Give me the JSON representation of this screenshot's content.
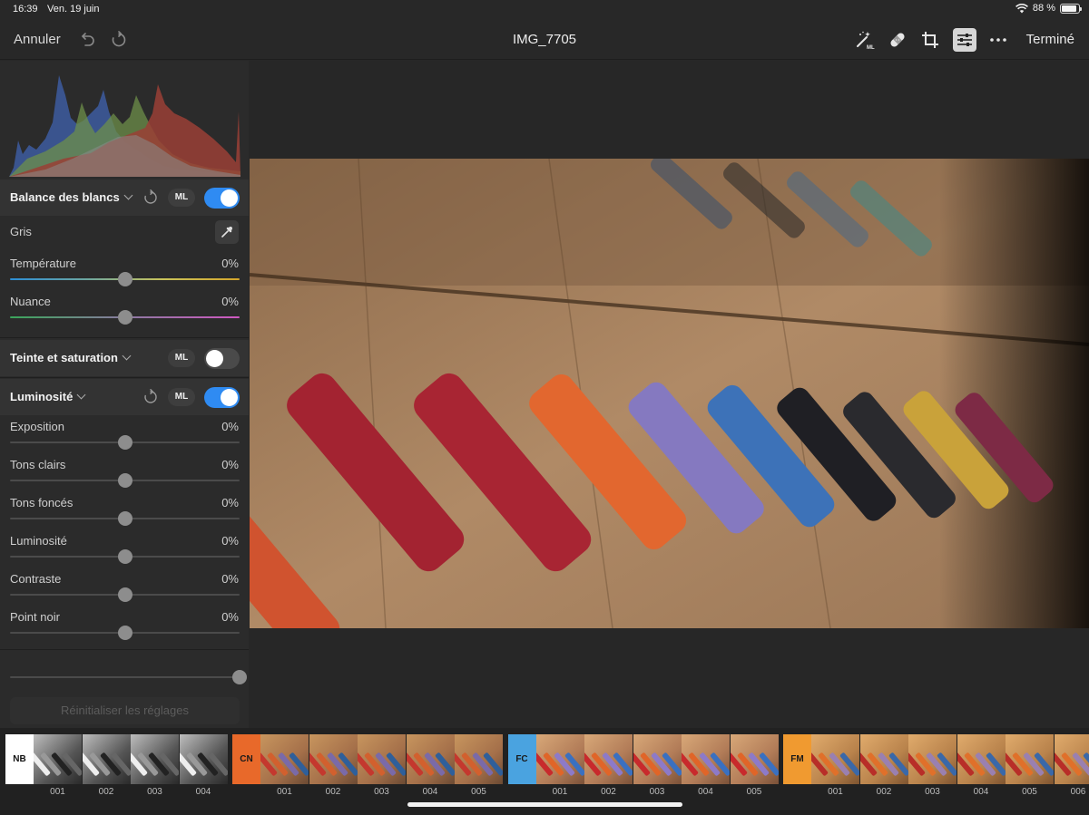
{
  "status": {
    "time": "16:39",
    "date": "Ven. 19 juin",
    "battery_pct": "88 %",
    "battery_level": 0.88
  },
  "toolbar": {
    "cancel_label": "Annuler",
    "title": "IMG_7705",
    "done_label": "Terminé",
    "icons": [
      "undo-icon",
      "redo-icon",
      "magic-wand-ml-icon",
      "bandage-icon",
      "crop-icon",
      "sliders-icon",
      "more-icon"
    ]
  },
  "white_balance": {
    "title": "Balance des blancs",
    "ml_label": "ML",
    "enabled": true,
    "gray_label": "Gris",
    "temperature": {
      "label": "Température",
      "value": "0%",
      "level": 0.5
    },
    "tint": {
      "label": "Nuance",
      "value": "0%",
      "level": 0.5
    }
  },
  "hue_saturation": {
    "title": "Teinte et saturation",
    "ml_label": "ML",
    "enabled": false
  },
  "luminosity": {
    "title": "Luminosité",
    "ml_label": "ML",
    "enabled": true,
    "sliders": [
      {
        "label": "Exposition",
        "value": "0%",
        "level": 0.5
      },
      {
        "label": "Tons clairs",
        "value": "0%",
        "level": 0.5
      },
      {
        "label": "Tons foncés",
        "value": "0%",
        "level": 0.5
      },
      {
        "label": "Luminosité",
        "value": "0%",
        "level": 0.5
      },
      {
        "label": "Contraste",
        "value": "0%",
        "level": 0.5
      },
      {
        "label": "Point noir",
        "value": "0%",
        "level": 0.5
      }
    ]
  },
  "intensity_level": 1.0,
  "reset_all_label": "Réinitialiser les réglages",
  "filmstrip": {
    "groups": [
      {
        "tag": "NB",
        "color": "#ffffff",
        "text_color": "#111111",
        "style": "bw",
        "items": [
          "001",
          "002",
          "003",
          "004"
        ]
      },
      {
        "tag": "CN",
        "color": "#e8692a",
        "text_color": "#1a1a1a",
        "style": "warm",
        "items": [
          "001",
          "002",
          "003",
          "004",
          "005"
        ]
      },
      {
        "tag": "FC",
        "color": "#4aa3e0",
        "text_color": "#1a1a1a",
        "style": "vivid",
        "items": [
          "001",
          "002",
          "003",
          "004",
          "005"
        ]
      },
      {
        "tag": "FM",
        "color": "#f09a30",
        "text_color": "#1a1a1a",
        "style": "amber",
        "items": [
          "001",
          "002",
          "003",
          "004",
          "005",
          "006"
        ]
      }
    ]
  },
  "colors": {
    "accent": "#2f8bf2",
    "panel_bg": "#2b2b2b",
    "section_bg": "#333333"
  }
}
